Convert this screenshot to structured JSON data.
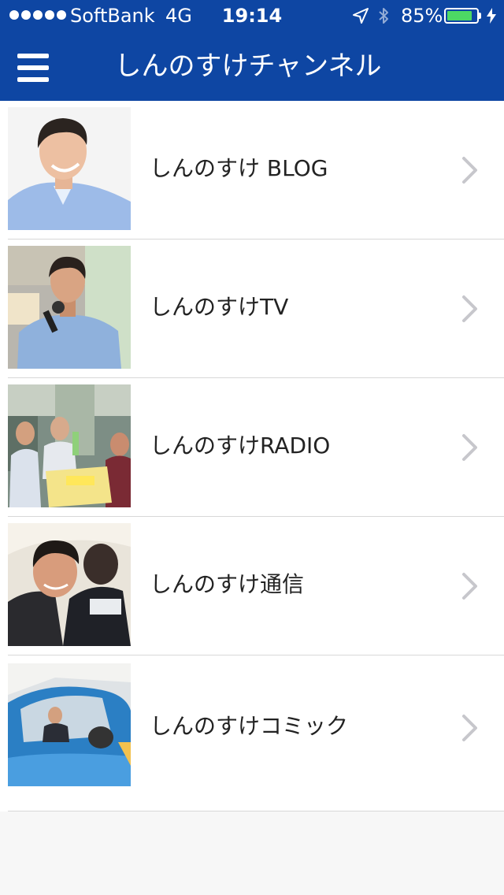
{
  "status_bar": {
    "carrier": "SoftBank",
    "network": "4G",
    "time": "19:14",
    "battery_percent": "85%",
    "battery_level": 0.85,
    "icons": [
      "signal-dots-icon",
      "location-arrow-icon",
      "bluetooth-icon",
      "battery-icon",
      "charging-bolt-icon"
    ]
  },
  "nav": {
    "title": "しんのすけチャンネル",
    "menu_icon": "hamburger-menu-icon"
  },
  "colors": {
    "nav_background": "#0e46a3",
    "battery_fill": "#4cd964",
    "list_background": "#ffffff",
    "page_background": "#f7f7f7"
  },
  "list": {
    "items": [
      {
        "label": "しんのすけ BLOG",
        "thumbnail": "portrait-smiling-man-photo",
        "chevron": "chevron-right-icon"
      },
      {
        "label": "しんのすけTV",
        "thumbnail": "man-speaking-microphone-photo",
        "chevron": "chevron-right-icon"
      },
      {
        "label": "しんのすけRADIO",
        "thumbnail": "radio-booth-people-photo",
        "chevron": "chevron-right-icon"
      },
      {
        "label": "しんのすけ通信",
        "thumbnail": "man-with-child-photo",
        "chevron": "chevron-right-icon"
      },
      {
        "label": "しんのすけコミック",
        "thumbnail": "man-in-blue-car-photo",
        "chevron": "chevron-right-icon"
      }
    ]
  }
}
